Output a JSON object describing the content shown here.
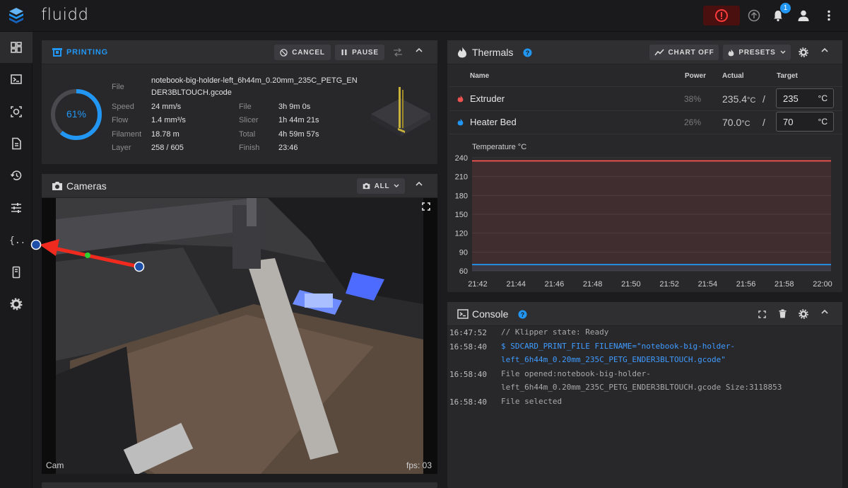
{
  "app": {
    "title": "fluidd",
    "notification_count": "1"
  },
  "printing": {
    "title": "PRINTING",
    "cancel_label": "CANCEL",
    "pause_label": "PAUSE",
    "progress_text": "61%",
    "progress_fraction": 0.61,
    "file_label": "File",
    "file_name_line1": "notebook-big-holder-left_6h44m_0.20mm_235C_PETG_EN",
    "file_name_line2": "DER3BLTOUCH.gcode",
    "speed_label": "Speed",
    "speed_value": "24 mm/s",
    "flow_label": "Flow",
    "flow_value": "1.4 mm³/s",
    "filament_label": "Filament",
    "filament_value": "18.78 m",
    "layer_label": "Layer",
    "layer_value": "258 / 605",
    "time_file_label": "File",
    "time_file_value": "3h 9m 0s",
    "slicer_label": "Slicer",
    "slicer_value": "1h 44m 21s",
    "total_label": "Total",
    "total_value": "4h 59m 57s",
    "finish_label": "Finish",
    "finish_value": "23:46"
  },
  "cameras": {
    "title": "Cameras",
    "all_label": "ALL",
    "cam_name": "Cam",
    "fps_text": "fps: 03"
  },
  "thermals": {
    "title": "Thermals",
    "chart_off_label": "CHART OFF",
    "presets_label": "PRESETS",
    "columns": {
      "name": "Name",
      "power": "Power",
      "actual": "Actual",
      "target": "Target"
    },
    "heaters": [
      {
        "name": "Extruder",
        "power": "38%",
        "actual": "235.4",
        "unit": "°C",
        "target": "235",
        "target_unit": "°C",
        "color": "#ef5350"
      },
      {
        "name": "Heater Bed",
        "power": "26%",
        "actual": "70.0",
        "unit": "°C",
        "target": "70",
        "target_unit": "°C",
        "color": "#2196f3"
      }
    ]
  },
  "chart_data": {
    "type": "line",
    "ylabel": "Temperature °C",
    "ylim": [
      60,
      240
    ],
    "yticks": [
      "240",
      "210",
      "180",
      "150",
      "120",
      "90",
      "60"
    ],
    "x": [
      "21:42",
      "21:44",
      "21:46",
      "21:48",
      "21:50",
      "21:52",
      "21:54",
      "21:56",
      "21:58",
      "22:00"
    ],
    "series": [
      {
        "name": "Extruder",
        "values": [
          235,
          235,
          235,
          235,
          235,
          235,
          235,
          235,
          235,
          235
        ],
        "color": "#ef5350"
      },
      {
        "name": "Heater Bed",
        "values": [
          70,
          70,
          70,
          70,
          70,
          70,
          70,
          70,
          70,
          70
        ],
        "color": "#2196f3"
      }
    ]
  },
  "console": {
    "title": "Console",
    "entries": [
      {
        "time": "16:47:52",
        "lines": [
          "// Klipper state: Ready"
        ],
        "is_cmd": false
      },
      {
        "time": "16:58:40",
        "lines": [
          "$ SDCARD_PRINT_FILE FILENAME=\"notebook-big-holder-",
          "left_6h44m_0.20mm_235C_PETG_ENDER3BLTOUCH.gcode\""
        ],
        "is_cmd": true
      },
      {
        "time": "16:58:40",
        "lines": [
          "File opened:notebook-big-holder-",
          "left_6h44m_0.20mm_235C_PETG_ENDER3BLTOUCH.gcode Size:3118853"
        ],
        "is_cmd": false
      },
      {
        "time": "16:58:40",
        "lines": [
          "File selected"
        ],
        "is_cmd": false
      }
    ]
  }
}
